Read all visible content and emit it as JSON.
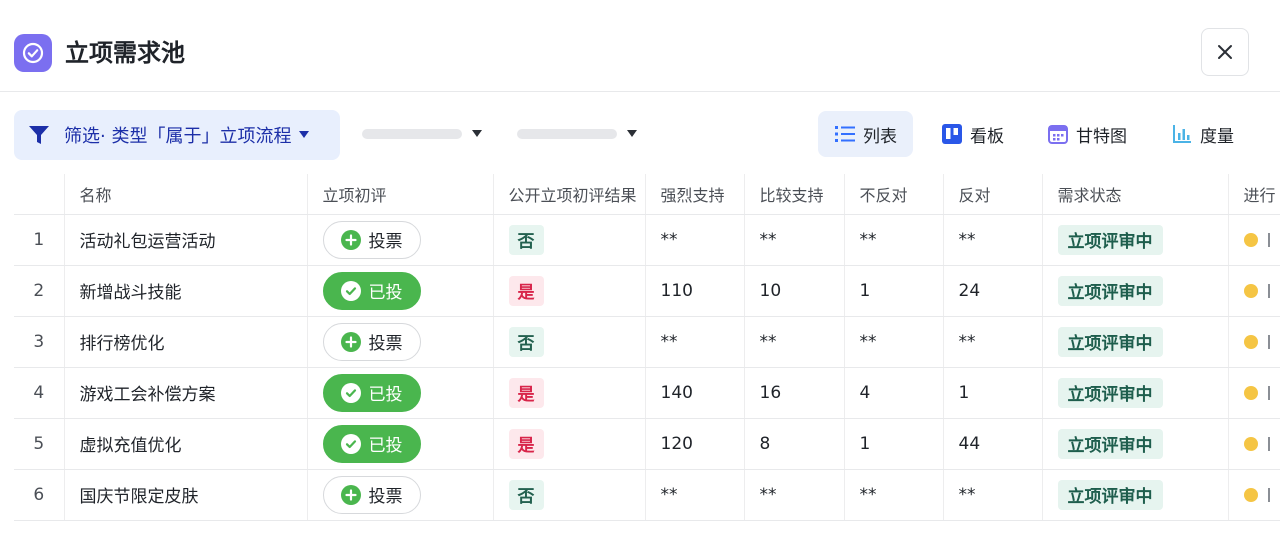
{
  "header": {
    "title": "立项需求池",
    "app_icon": "check-circle-icon",
    "close_icon": "close-icon"
  },
  "toolbar": {
    "filter_label": "筛选· 类型「属于」立项流程",
    "views": [
      {
        "label": "列表",
        "icon": "list-icon",
        "active": true
      },
      {
        "label": "看板",
        "icon": "kanban-icon",
        "active": false
      },
      {
        "label": "甘特图",
        "icon": "gantt-icon",
        "active": false
      },
      {
        "label": "度量",
        "icon": "bar-chart-icon",
        "active": false
      }
    ]
  },
  "table": {
    "columns": [
      "",
      "名称",
      "立项初评",
      "公开立项初评结果",
      "强烈支持",
      "比较支持",
      "不反对",
      "反对",
      "需求状态",
      "进行"
    ],
    "rows": [
      {
        "idx": "1",
        "name": "活动礼包运营活动",
        "vote": "投票",
        "voted": false,
        "result": "否",
        "strong": "**",
        "support": "**",
        "neutral": "**",
        "oppose": "**",
        "status": "立项评审中"
      },
      {
        "idx": "2",
        "name": "新增战斗技能",
        "vote": "已投",
        "voted": true,
        "result": "是",
        "strong": "110",
        "support": "10",
        "neutral": "1",
        "oppose": "24",
        "status": "立项评审中"
      },
      {
        "idx": "3",
        "name": "排行榜优化",
        "vote": "投票",
        "voted": false,
        "result": "否",
        "strong": "**",
        "support": "**",
        "neutral": "**",
        "oppose": "**",
        "status": "立项评审中"
      },
      {
        "idx": "4",
        "name": "游戏工会补偿方案",
        "vote": "已投",
        "voted": true,
        "result": "是",
        "strong": "140",
        "support": "16",
        "neutral": "4",
        "oppose": "1",
        "status": "立项评审中"
      },
      {
        "idx": "5",
        "name": "虚拟充值优化",
        "vote": "已投",
        "voted": true,
        "result": "是",
        "strong": "120",
        "support": "8",
        "neutral": "1",
        "oppose": "44",
        "status": "立项评审中"
      },
      {
        "idx": "6",
        "name": "国庆节限定皮肤",
        "vote": "投票",
        "voted": false,
        "result": "否",
        "strong": "**",
        "support": "**",
        "neutral": "**",
        "oppose": "**",
        "status": "立项评审中"
      }
    ]
  },
  "colors": {
    "accent": "#7b6ff0",
    "voted": "#4ab64e",
    "filter_text": "#1c2fa8",
    "yes_tag": "#d8254a",
    "status_dot": "#f5c544"
  }
}
